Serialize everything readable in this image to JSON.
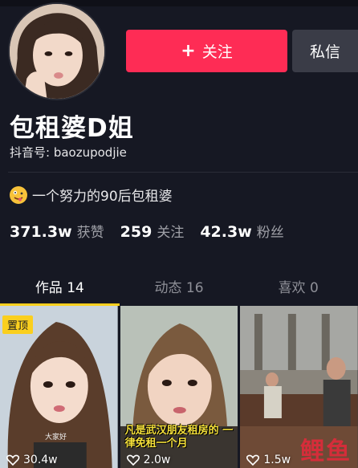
{
  "profile": {
    "nickname": "包租婆D姐",
    "douyin_id_label": "抖音号: baozupodjie",
    "bio": "一个努力的90后包租婆",
    "bio_emoji": "zany-face-icon"
  },
  "actions": {
    "follow_plus": "+",
    "follow_label": "关注",
    "message_label": "私信",
    "follow_color": "#fe2c55"
  },
  "stats": [
    {
      "value": "371.3w",
      "label": "获赞"
    },
    {
      "value": "259",
      "label": "关注"
    },
    {
      "value": "42.3w",
      "label": "粉丝"
    }
  ],
  "tabs": [
    {
      "label": "作品 14",
      "active": true
    },
    {
      "label": "动态 16",
      "active": false
    },
    {
      "label": "喜欢 0",
      "active": false
    }
  ],
  "videos": [
    {
      "likes": "30.4w",
      "pinned_label": "置顶",
      "small_caption": "大家好"
    },
    {
      "likes": "2.0w",
      "caption": "凡是武汉朋友租房的 一律免租一个月"
    },
    {
      "likes": "1.5w"
    }
  ],
  "watermark": "鲤鱼",
  "colors": {
    "background": "#161823",
    "accent_tab": "#facf1e",
    "secondary_button": "#3a3c47"
  }
}
